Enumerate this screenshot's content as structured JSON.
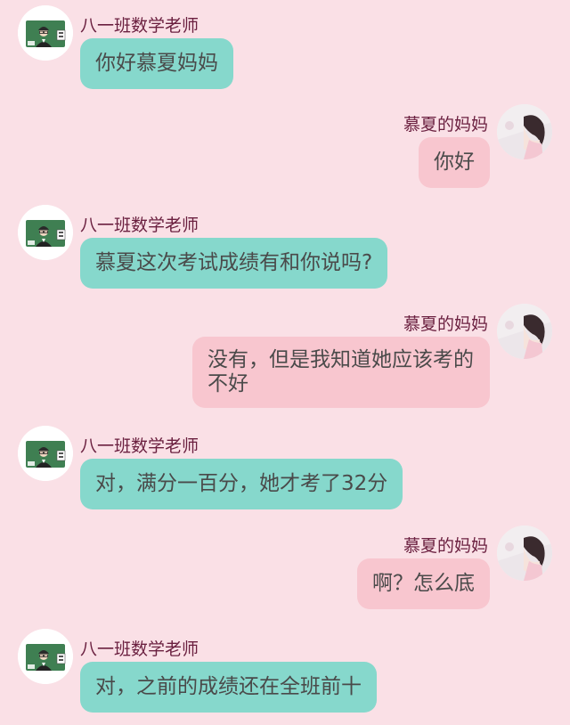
{
  "conversation": {
    "teacher_name": "八一班数学老师",
    "mother_name": "慕夏的妈妈",
    "messages": [
      {
        "sender": "teacher",
        "name": "八一班数学老师",
        "text": "你好慕夏妈妈"
      },
      {
        "sender": "mother",
        "name": "慕夏的妈妈",
        "text": "你好"
      },
      {
        "sender": "teacher",
        "name": "八一班数学老师",
        "text": "慕夏这次考试成绩有和你说吗?"
      },
      {
        "sender": "mother",
        "name": "慕夏的妈妈",
        "text": "没有，但是我知道她应该考的不好"
      },
      {
        "sender": "teacher",
        "name": "八一班数学老师",
        "text": "对，满分一百分，她才考了32分"
      },
      {
        "sender": "mother",
        "name": "慕夏的妈妈",
        "text": "啊？怎么底"
      },
      {
        "sender": "teacher",
        "name": "八一班数学老师",
        "text": "对，之前的成绩还在全班前十"
      }
    ]
  },
  "colors": {
    "background": "#fae0e6",
    "teacher_bubble": "#86d8cc",
    "mother_bubble": "#f8c6cf",
    "name_text": "#6a1f3f",
    "message_text": "#4a4a4a"
  },
  "icons": {
    "teacher_avatar": "teacher-chalkboard-avatar",
    "mother_avatar": "girl-photo-avatar"
  }
}
